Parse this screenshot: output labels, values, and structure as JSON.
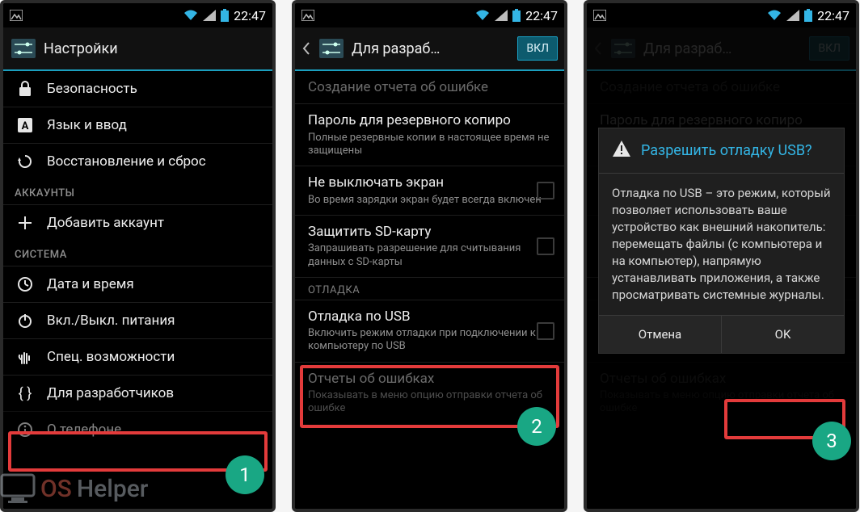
{
  "status": {
    "time": "22:47"
  },
  "screen1": {
    "title": "Настройки",
    "items": [
      {
        "icon": "lock",
        "label": "Безопасность"
      },
      {
        "icon": "lang",
        "label": "Язык и ввод"
      },
      {
        "icon": "restore",
        "label": "Восстановление и сброс"
      }
    ],
    "section_accounts": "АККАУНТЫ",
    "add_account": "Добавить аккаунт",
    "section_system": "СИСТЕМА",
    "sysitems": [
      {
        "icon": "clock",
        "label": "Дата и время"
      },
      {
        "icon": "power",
        "label": "Вкл./Выкл. питания"
      },
      {
        "icon": "hand",
        "label": "Спец. возможности"
      },
      {
        "icon": "braces",
        "label": "Для разработчиков"
      },
      {
        "icon": "info",
        "label": "О телефоне"
      }
    ],
    "badge": "1"
  },
  "screen2": {
    "title": "Для разраб…",
    "toggle": "ВКЛ",
    "items": {
      "bugreport": {
        "primary": "Создание отчета об ошибке"
      },
      "backup_pwd": {
        "primary": "Пароль для резервного копиро",
        "secondary": "Полные резервные копии в настоящее время не защищены"
      },
      "stay_awake": {
        "primary": "Не выключать экран",
        "secondary": "Во время зарядки экран будет всегда включен"
      },
      "protect_sd": {
        "primary": "Защитить SD-карту",
        "secondary": "Запрашивать разрешение для считывания данных с SD-карты"
      },
      "section_debug": "ОТЛАДКА",
      "usb_debug": {
        "primary": "Отладка по USB",
        "secondary": "Включить режим отладки при подключении к компьютеру по USB"
      },
      "error_reports": {
        "primary": "Отчеты об ошибках",
        "secondary": "Показывать в меню опцию отправки отчета об ошибке"
      }
    },
    "badge": "2"
  },
  "screen3": {
    "title": "Для разраб…",
    "toggle": "ВКЛ",
    "dialog": {
      "title": "Разрешить отладку USB?",
      "body": "Отладка по USB – это режим, который позволяет использовать ваше устройство как внешний накопитель: перемещать файлы (с компьютера и на компьютер), напрямую устанавливать приложения, а также просматривать системные журналы.",
      "cancel": "Отмена",
      "ok": "OK"
    },
    "badge": "3"
  },
  "watermark": {
    "os": "OS",
    "helper": "Helper"
  }
}
